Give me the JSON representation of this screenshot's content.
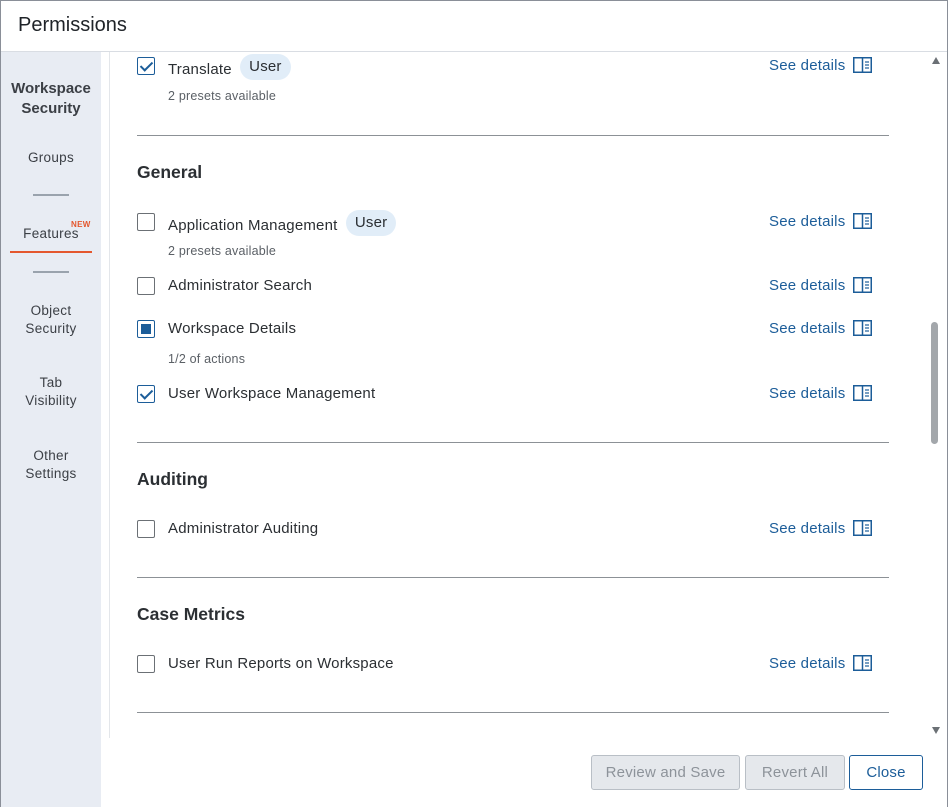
{
  "window": {
    "title": "Permissions"
  },
  "sidebar": {
    "section_title": "Workspace Security",
    "items": [
      {
        "label": "Groups"
      },
      {
        "label": "Features",
        "badge": "NEW",
        "active": true
      },
      {
        "label": "Object Security"
      },
      {
        "label": "Tab Visibility"
      },
      {
        "label": "Other Settings"
      }
    ],
    "accent_color": "#e4572e"
  },
  "content": {
    "see_details_label": "See details",
    "top_item": {
      "label": "Translate",
      "tag": "User",
      "subtext": "2 presets available",
      "state": "checked"
    },
    "sections": [
      {
        "title": "General",
        "items": [
          {
            "label": "Application Management",
            "tag": "User",
            "subtext": "2 presets available",
            "state": "unchecked"
          },
          {
            "label": "Administrator Search",
            "state": "unchecked"
          },
          {
            "label": "Workspace Details",
            "subtext": "1/2 of actions",
            "state": "partial"
          },
          {
            "label": "User Workspace Management",
            "state": "checked"
          }
        ]
      },
      {
        "title": "Auditing",
        "items": [
          {
            "label": "Administrator Auditing",
            "state": "unchecked"
          }
        ]
      },
      {
        "title": "Case Metrics",
        "items": [
          {
            "label": "User Run Reports on Workspace",
            "state": "unchecked"
          }
        ]
      }
    ]
  },
  "footer": {
    "review_save_label": "Review and Save",
    "revert_all_label": "Revert All",
    "close_label": "Close"
  },
  "colors": {
    "link": "#1c5d99",
    "sidebar_bg": "#e8ecf3",
    "tag_bg": "#e1edf8"
  }
}
